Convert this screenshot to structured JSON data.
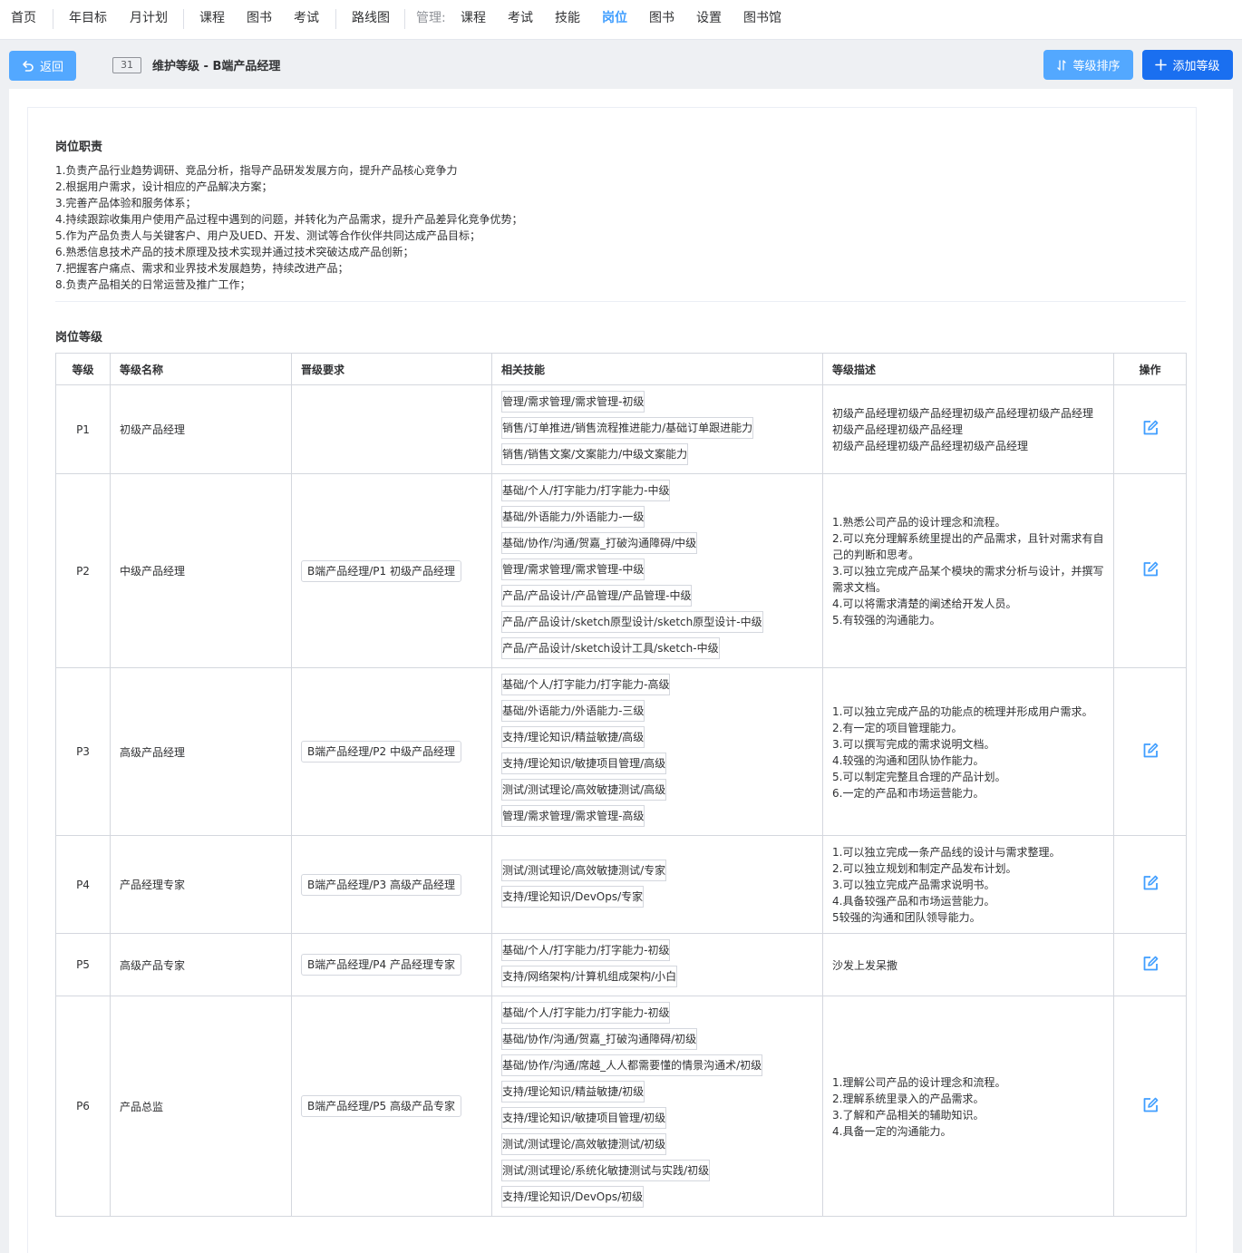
{
  "nav": {
    "items": [
      "首页",
      "年目标",
      "月计划",
      "课程",
      "图书",
      "考试",
      "路线图"
    ],
    "manage_label": "管理:",
    "manage_items": [
      "课程",
      "考试",
      "技能",
      "岗位",
      "图书",
      "设置",
      "图书馆"
    ],
    "active": "岗位"
  },
  "toolbar": {
    "back_label": "返回",
    "count": "31",
    "title": "维护等级 - B端产品经理",
    "sort_label": "等级排序",
    "add_label": "添加等级"
  },
  "duties": {
    "title": "岗位职责",
    "lines": [
      "1.负责产品行业趋势调研、竞品分析，指导产品研发发展方向，提升产品核心竞争力",
      "2.根据用户需求，设计相应的产品解决方案；",
      "3.完善产品体验和服务体系；",
      "4.持续跟踪收集用户使用产品过程中遇到的问题，并转化为产品需求，提升产品差异化竞争优势；",
      "5.作为产品负责人与关键客户、用户及UED、开发、测试等合作伙伴共同达成产品目标；",
      "6.熟悉信息技术产品的技术原理及技术实现并通过技术突破达成产品创新；",
      "7.把握客户痛点、需求和业界技术发展趋势，持续改进产品；",
      "8.负责产品相关的日常运营及推广工作；"
    ]
  },
  "levels": {
    "title": "岗位等级",
    "headers": [
      "等级",
      "等级名称",
      "晋级要求",
      "相关技能",
      "等级描述",
      "操作"
    ],
    "rows": [
      {
        "level": "P1",
        "name": "初级产品经理",
        "requirement": "",
        "skills": [
          "管理/需求管理/需求管理-初级",
          "销售/订单推进/销售流程推进能力/基础订单跟进能力",
          "销售/销售文案/文案能力/中级文案能力"
        ],
        "description": [
          "初级产品经理初级产品经理初级产品经理初级产品经理",
          "初级产品经理初级产品经理",
          "初级产品经理初级产品经理初级产品经理"
        ]
      },
      {
        "level": "P2",
        "name": "中级产品经理",
        "requirement": "B端产品经理/P1 初级产品经理",
        "skills": [
          "基础/个人/打字能力/打字能力-中级",
          "基础/外语能力/外语能力-一级",
          "基础/协作/沟通/贺嘉_打破沟通障碍/中级",
          "管理/需求管理/需求管理-中级",
          "产品/产品设计/产品管理/产品管理-中级",
          "产品/产品设计/sketch原型设计/sketch原型设计-中级",
          "产品/产品设计/sketch设计工具/sketch-中级"
        ],
        "description": [
          "1.熟悉公司产品的设计理念和流程。",
          "2.可以充分理解系统里提出的产品需求，且针对需求有自己的判断和思考。",
          "3.可以独立完成产品某个模块的需求分析与设计，并撰写需求文档。",
          "4.可以将需求清楚的阐述给开发人员。",
          "5.有较强的沟通能力。"
        ]
      },
      {
        "level": "P3",
        "name": "高级产品经理",
        "requirement": "B端产品经理/P2 中级产品经理",
        "skills": [
          "基础/个人/打字能力/打字能力-高级",
          "基础/外语能力/外语能力-三级",
          "支持/理论知识/精益敏捷/高级",
          "支持/理论知识/敏捷项目管理/高级",
          "测试/测试理论/高效敏捷测试/高级",
          "管理/需求管理/需求管理-高级"
        ],
        "description": [
          "1.可以独立完成产品的功能点的梳理并形成用户需求。",
          "2.有一定的项目管理能力。",
          "3.可以撰写完成的需求说明文档。",
          "4.较强的沟通和团队协作能力。",
          "5.可以制定完整且合理的产品计划。",
          "6.一定的产品和市场运营能力。"
        ]
      },
      {
        "level": "P4",
        "name": "产品经理专家",
        "requirement": "B端产品经理/P3 高级产品经理",
        "skills": [
          "测试/测试理论/高效敏捷测试/专家",
          "支持/理论知识/DevOps/专家"
        ],
        "description": [
          "1.可以独立完成一条产品线的设计与需求整理。",
          "2.可以独立规划和制定产品发布计划。",
          "3.可以独立完成产品需求说明书。",
          "4.具备较强产品和市场运营能力。",
          "5较强的沟通和团队领导能力。"
        ]
      },
      {
        "level": "P5",
        "name": "高级产品专家",
        "requirement": "B端产品经理/P4 产品经理专家",
        "skills": [
          "基础/个人/打字能力/打字能力-初级",
          "支持/网络架构/计算机组成架构/小白"
        ],
        "description": [
          "沙发上发呆撒"
        ]
      },
      {
        "level": "P6",
        "name": "产品总监",
        "requirement": "B端产品经理/P5 高级产品专家",
        "skills": [
          "基础/个人/打字能力/打字能力-初级",
          "基础/协作/沟通/贺嘉_打破沟通障碍/初级",
          "基础/协作/沟通/席越_人人都需要懂的情景沟通术/初级",
          "支持/理论知识/精益敏捷/初级",
          "支持/理论知识/敏捷项目管理/初级",
          "测试/测试理论/高效敏捷测试/初级",
          "测试/测试理论/系统化敏捷测试与实践/初级",
          "支持/理论知识/DevOps/初级"
        ],
        "description": [
          "1.理解公司产品的设计理念和流程。",
          "2.理解系统里录入的产品需求。",
          "3.了解和产品相关的辅助知识。",
          "4.具备一定的沟通能力。"
        ]
      }
    ]
  },
  "colors": {
    "primary": "#409eff",
    "button_light": "#53a8ff",
    "button_dark": "#1a6ff0",
    "border": "#d4d7de"
  },
  "icons": {
    "back": "back-arrow-icon",
    "sort": "sort-icon",
    "add": "plus-icon",
    "edit": "edit-icon"
  }
}
